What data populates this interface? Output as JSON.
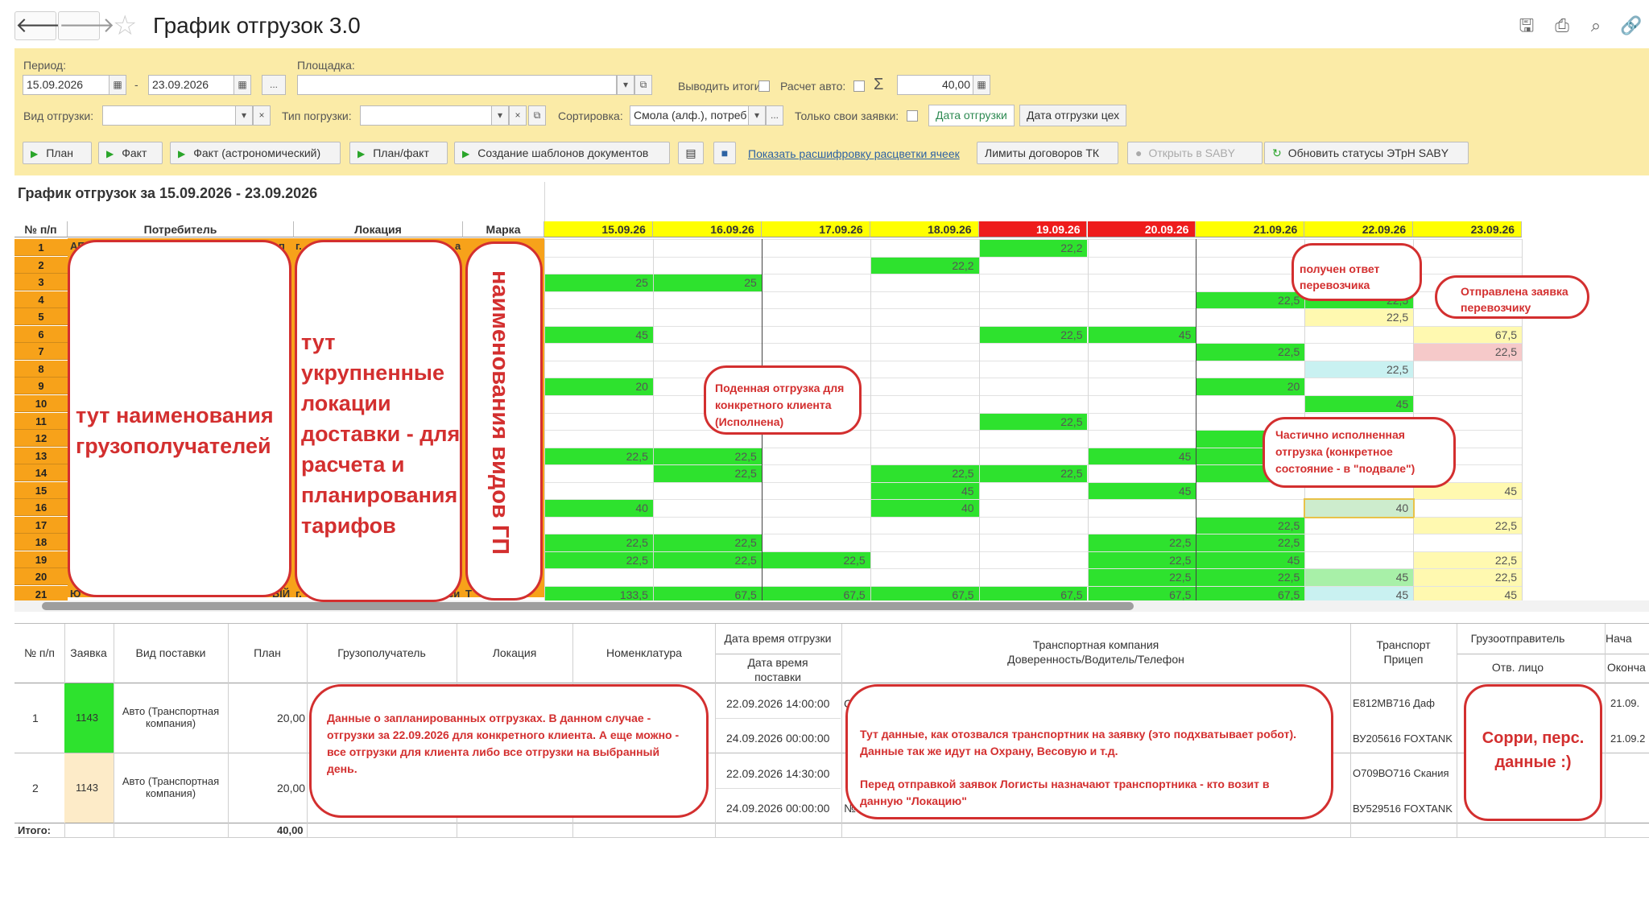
{
  "window": {
    "title": "График отгрузок 3.0"
  },
  "filters": {
    "period_label": "Период:",
    "period_from": "15.09.2026",
    "period_to": "23.09.2026",
    "period_sep": "-",
    "site_label": "Площадка:",
    "show_totals_label": "Выводить итоги:",
    "auto_calc_label": "Расчет авто:",
    "sum_value": "40,00",
    "ship_kind_label": "Вид отгрузки:",
    "load_type_label": "Тип погрузки:",
    "sort_label": "Сортировка:",
    "sort_value": "Смола (алф.), потреб",
    "own_only_label": "Только свои заявки:",
    "date_toggle": [
      "Дата отгрузки",
      "Дата отгрузки цех"
    ],
    "ellipsis": "..."
  },
  "toolbar": {
    "plan": "План",
    "fact": "Факт",
    "fact_astro": "Факт (астрономический)",
    "plan_fact": "План/факт",
    "templates": "Создание шаблонов документов",
    "legend_link": "Показать расшифровку расцветки ячеек",
    "limits": "Лимиты договоров ТК",
    "open_saby": "Открыть в SABY",
    "refresh_saby": "Обновить статусы ЭТрН SABY"
  },
  "report": {
    "title": "График отгрузок за 15.09.2026 - 23.09.2026",
    "headers": {
      "num": "№ п/п",
      "consumer": "Потребитель",
      "location": "Локация",
      "brand": "Марка"
    },
    "dates": [
      "15.09.26",
      "16.09.26",
      "17.09.26",
      "18.09.26",
      "19.09.26",
      "20.09.26",
      "21.09.26",
      "22.09.26",
      "23.09.26"
    ],
    "row_numbers": [
      "1",
      "2",
      "3",
      "4",
      "5",
      "6",
      "7",
      "8",
      "9",
      "10",
      "11",
      "12",
      "13",
      "14",
      "15",
      "16",
      "17",
      "18",
      "19",
      "20",
      "21"
    ],
    "cells": [
      {
        "r": 0,
        "c": 4,
        "v": "22,2",
        "bg": "#2ee22e"
      },
      {
        "r": 1,
        "c": 3,
        "v": "22,2",
        "bg": "#2ee22e"
      },
      {
        "r": 2,
        "c": 0,
        "v": "25",
        "bg": "#2ee22e"
      },
      {
        "r": 2,
        "c": 1,
        "v": "25",
        "bg": "#2ee22e"
      },
      {
        "r": 3,
        "c": 6,
        "v": "22,5",
        "bg": "#2ee22e"
      },
      {
        "r": 3,
        "c": 7,
        "v": "22,5",
        "bg": "#2ee22e"
      },
      {
        "r": 4,
        "c": 7,
        "v": "22,5",
        "bg": "#fff9b0"
      },
      {
        "r": 5,
        "c": 0,
        "v": "45",
        "bg": "#2ee22e"
      },
      {
        "r": 5,
        "c": 4,
        "v": "22,5",
        "bg": "#2ee22e"
      },
      {
        "r": 5,
        "c": 5,
        "v": "45",
        "bg": "#2ee22e"
      },
      {
        "r": 5,
        "c": 8,
        "v": "67,5",
        "bg": "#fff9b0"
      },
      {
        "r": 6,
        "c": 6,
        "v": "22,5",
        "bg": "#2ee22e"
      },
      {
        "r": 6,
        "c": 8,
        "v": "22,5",
        "bg": "#f6c9c9"
      },
      {
        "r": 7,
        "c": 7,
        "v": "22,5",
        "bg": "#c9f1f1"
      },
      {
        "r": 8,
        "c": 0,
        "v": "20",
        "bg": "#2ee22e"
      },
      {
        "r": 8,
        "c": 6,
        "v": "20",
        "bg": "#2ee22e"
      },
      {
        "r": 9,
        "c": 7,
        "v": "45",
        "bg": "#2ee22e"
      },
      {
        "r": 10,
        "c": 4,
        "v": "22,5",
        "bg": "#2ee22e"
      },
      {
        "r": 11,
        "c": 6,
        "v": "",
        "bg": "#2ee22e"
      },
      {
        "r": 12,
        "c": 0,
        "v": "22,5",
        "bg": "#2ee22e"
      },
      {
        "r": 12,
        "c": 1,
        "v": "22,5",
        "bg": "#2ee22e"
      },
      {
        "r": 12,
        "c": 5,
        "v": "45",
        "bg": "#2ee22e"
      },
      {
        "r": 12,
        "c": 6,
        "v": "",
        "bg": "#2ee22e"
      },
      {
        "r": 13,
        "c": 1,
        "v": "22,5",
        "bg": "#2ee22e"
      },
      {
        "r": 13,
        "c": 3,
        "v": "22,5",
        "bg": "#2ee22e"
      },
      {
        "r": 13,
        "c": 4,
        "v": "22,5",
        "bg": "#2ee22e"
      },
      {
        "r": 13,
        "c": 6,
        "v": "",
        "bg": "#2ee22e"
      },
      {
        "r": 14,
        "c": 3,
        "v": "45",
        "bg": "#2ee22e"
      },
      {
        "r": 14,
        "c": 5,
        "v": "45",
        "bg": "#2ee22e"
      },
      {
        "r": 14,
        "c": 8,
        "v": "45",
        "bg": "#fff9b0"
      },
      {
        "r": 15,
        "c": 0,
        "v": "40",
        "bg": "#2ee22e"
      },
      {
        "r": 15,
        "c": 3,
        "v": "40",
        "bg": "#2ee22e"
      },
      {
        "r": 15,
        "c": 7,
        "v": "40",
        "bg": "#cdeccd"
      },
      {
        "r": 16,
        "c": 6,
        "v": "22,5",
        "bg": "#2ee22e"
      },
      {
        "r": 16,
        "c": 8,
        "v": "22,5",
        "bg": "#fff9b0"
      },
      {
        "r": 17,
        "c": 0,
        "v": "22,5",
        "bg": "#2ee22e"
      },
      {
        "r": 17,
        "c": 1,
        "v": "22,5",
        "bg": "#2ee22e"
      },
      {
        "r": 17,
        "c": 5,
        "v": "22,5",
        "bg": "#2ee22e"
      },
      {
        "r": 17,
        "c": 6,
        "v": "22,5",
        "bg": "#2ee22e"
      },
      {
        "r": 18,
        "c": 0,
        "v": "22,5",
        "bg": "#2ee22e"
      },
      {
        "r": 18,
        "c": 1,
        "v": "22,5",
        "bg": "#2ee22e"
      },
      {
        "r": 18,
        "c": 2,
        "v": "22,5",
        "bg": "#2ee22e"
      },
      {
        "r": 18,
        "c": 5,
        "v": "22,5",
        "bg": "#2ee22e"
      },
      {
        "r": 18,
        "c": 6,
        "v": "45",
        "bg": "#2ee22e"
      },
      {
        "r": 18,
        "c": 8,
        "v": "22,5",
        "bg": "#fff9b0"
      },
      {
        "r": 19,
        "c": 5,
        "v": "22,5",
        "bg": "#2ee22e"
      },
      {
        "r": 19,
        "c": 6,
        "v": "22,5",
        "bg": "#2ee22e"
      },
      {
        "r": 19,
        "c": 7,
        "v": "45",
        "bg": "#a8f0a8"
      },
      {
        "r": 19,
        "c": 8,
        "v": "22,5",
        "bg": "#fff9b0"
      },
      {
        "r": 20,
        "c": 0,
        "v": "133,5",
        "bg": "#2ee22e"
      },
      {
        "r": 20,
        "c": 1,
        "v": "67,5",
        "bg": "#2ee22e"
      },
      {
        "r": 20,
        "c": 2,
        "v": "67,5",
        "bg": "#2ee22e"
      },
      {
        "r": 20,
        "c": 3,
        "v": "67,5",
        "bg": "#2ee22e"
      },
      {
        "r": 20,
        "c": 4,
        "v": "67,5",
        "bg": "#2ee22e"
      },
      {
        "r": 20,
        "c": 5,
        "v": "67,5",
        "bg": "#2ee22e"
      },
      {
        "r": 20,
        "c": 6,
        "v": "67,5",
        "bg": "#2ee22e"
      },
      {
        "r": 20,
        "c": 7,
        "v": "45",
        "bg": "#c9f1f1"
      },
      {
        "r": 20,
        "c": 8,
        "v": "45",
        "bg": "#fff9b0"
      }
    ],
    "partial_text": {
      "r1": "АЕ",
      "r2": "А",
      "r1_loc": "г.",
      "r1_cut": "оп",
      "r1_cut2": "а",
      "r20": "Т",
      "r21": "Ю",
      "r21b": "ЫЙ",
      "r21c": "г.",
      "r21d": "си",
      "mark_r21": "Т"
    }
  },
  "details": {
    "headers": {
      "num": "№ п/п",
      "order": "Заявка",
      "supply_type": "Вид поставки",
      "plan": "План",
      "consignee": "Грузополучатель",
      "location": "Локация",
      "nomenclature": "Номенклатура",
      "ship_dt": "Дата время отгрузки",
      "deliv_dt": "Дата время поставки",
      "tc": "Транспортная компания\nДоверенность/Водитель/Телефон",
      "transport": "Транспорт\nПрицеп",
      "shipper": "Грузоотправитель",
      "resp": "Отв. лицо",
      "start": "Нача",
      "end": "Оконча"
    },
    "rows": [
      {
        "num": "1",
        "order": "1143",
        "order_bg": "#2ee22e",
        "type": "Авто (Транспортная компания)",
        "plan": "20,00",
        "ship": "22.09.2026 14:00:00",
        "deliv": "24.09.2026 00:00:00",
        "truck": "Е812МВ716 Даф",
        "trailer": "ВУ205616 FOXTANK",
        "s1": "21.09.",
        "s2": "21.09.2",
        "tc_frag": "С"
      },
      {
        "num": "2",
        "order": "1143",
        "order_bg": "#fdebc8",
        "type": "Авто (Транспортная компания)",
        "plan": "20,00",
        "ship": "22.09.2026 14:30:00",
        "deliv": "24.09.2026 00:00:00",
        "truck": "О709ВО716 Скания",
        "trailer": "ВУ529516 FOXTANK",
        "s1": "",
        "s2": "",
        "tc_frag": "№"
      }
    ],
    "total_label": "Итого:",
    "total_plan": "40,00"
  },
  "annotations": {
    "consumers": "тут наименования грузополучателей",
    "locations": "тут укрупненные локации доставки - для расчета и планирования тарифов",
    "brands": "наименования видов ГП",
    "carrier_reply": "получен ответ перевозчика",
    "request_sent": "Отправлена заявка перевозчику",
    "daily_shipment": "Поденная отгрузка для конкретного клиента (Исполнена)",
    "partial": "Частично исполненная отгрузка (конкретное состояние - в \"подвале\")",
    "planned_data": "Данные о запланированных отгрузках. В данном случае - отгрузки за 22.09.2026 для конкретного клиента. А еще можно - все отгрузки для клиента либо все отгрузки на выбранный день.",
    "carrier_data_1": "Тут данные, как отозвался транспортник на заявку (это подхватывает робот). Данные так же идут на Охрану, Весовую и т.д.",
    "carrier_data_2": "Перед отправкой заявок Логисты назначают транспортника - кто возит в данную \"Локацию\"",
    "sorry": "Сорри, перс. данные :)"
  },
  "colors": {
    "accent_green": "#2ee22e",
    "filter_bg": "#fbeba7",
    "row_num_orange": "#f7a21a",
    "date_header_yellow": "#ffff00",
    "weekend_red": "#ee1c1c",
    "annotation_red": "#d32f2f"
  }
}
